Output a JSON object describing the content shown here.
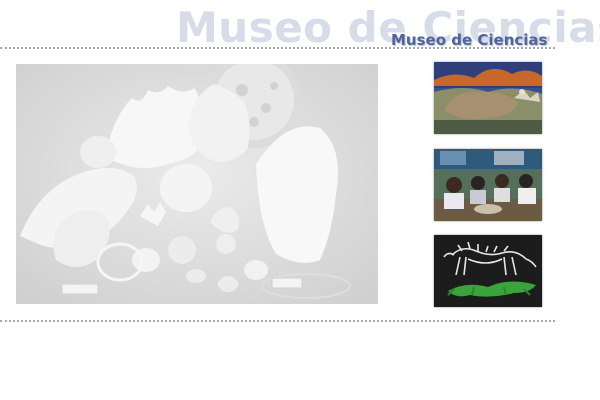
{
  "header": {
    "watermark_text": "Museo de Ciencias",
    "title": "Museo de Ciencias"
  },
  "hero_image": {
    "icon": "shells-coral-collection-photo",
    "labels": [
      "",
      ""
    ]
  },
  "thumbnails": [
    {
      "icon": "diorama-animal-photo"
    },
    {
      "icon": "visitors-workshop-photo"
    },
    {
      "icon": "dinosaur-skeleton-photo"
    }
  ]
}
